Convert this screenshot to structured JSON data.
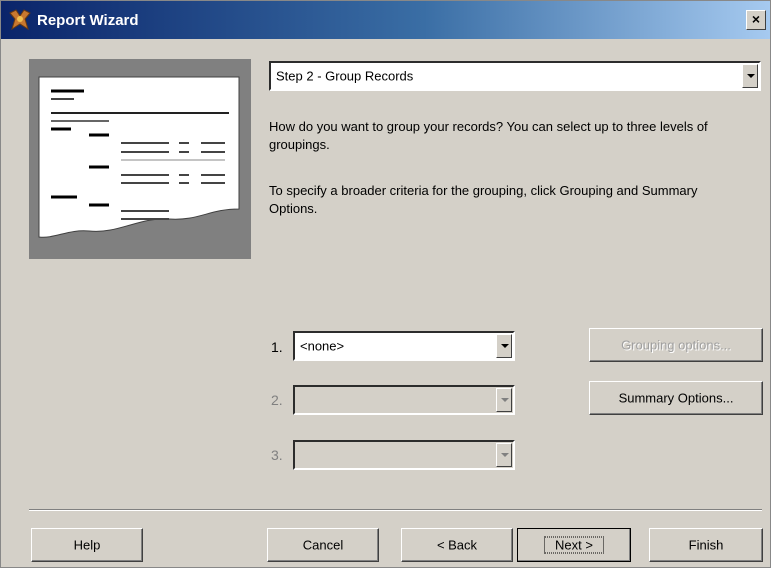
{
  "window": {
    "title": "Report Wizard",
    "close_label": "×"
  },
  "step_select": {
    "value": "Step 2 - Group Records"
  },
  "description": {
    "line1": "How do you want to group your records? You can select up to three levels of groupings.",
    "line2": "To specify a broader criteria for the grouping, click Grouping and Summary Options."
  },
  "groupings": [
    {
      "number": "1.",
      "value": "<none>",
      "enabled": true
    },
    {
      "number": "2.",
      "value": "",
      "enabled": false
    },
    {
      "number": "3.",
      "value": "",
      "enabled": false
    }
  ],
  "side_buttons": {
    "grouping_options": "Grouping options...",
    "summary_options": "Summary Options..."
  },
  "footer": {
    "help": "Help",
    "cancel": "Cancel",
    "back": "< Back",
    "next": "Next >",
    "finish": "Finish"
  },
  "colors": {
    "titlebar_start": "#0a246a",
    "titlebar_end": "#a6caf0",
    "face": "#d4d0c8"
  }
}
